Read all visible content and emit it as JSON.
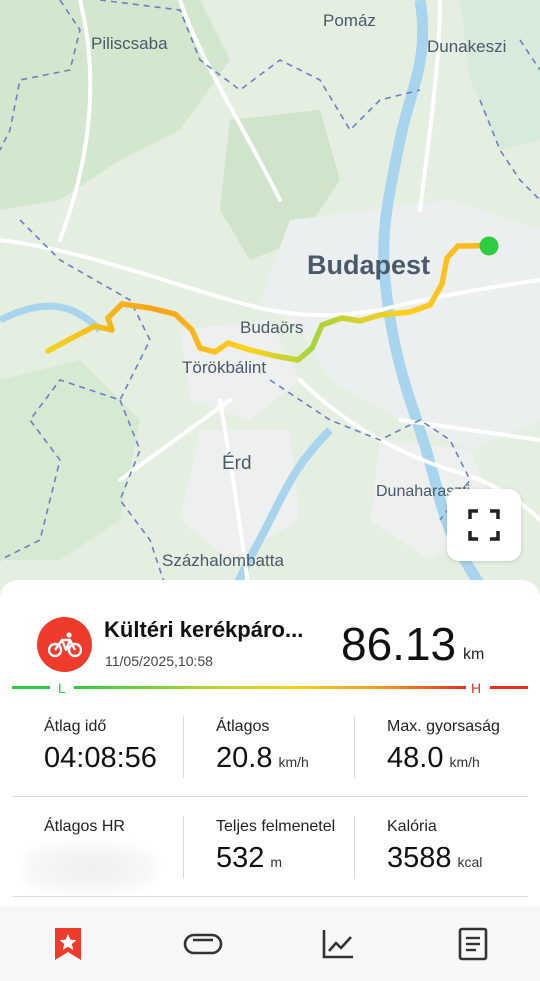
{
  "map": {
    "place_labels": [
      "Pomáz",
      "Piliscsaba",
      "Dunakeszi",
      "Budapest",
      "Budaörs",
      "Törökbálint",
      "Érd",
      "Dunaharaszti",
      "Százhalombatta"
    ]
  },
  "colors": {
    "accent": "#ef3b2c",
    "low": "#2ecc40",
    "high": "#e8321e",
    "route_start": "#2ecc40"
  },
  "activity": {
    "icon": "cycling-icon",
    "title": "Kültéri kerékpáro...",
    "datetime": "11/05/2025,10:58",
    "distance": "86.13",
    "distance_unit": "km"
  },
  "scale": {
    "low_label": "L",
    "high_label": "H"
  },
  "stats": {
    "avg_time": {
      "label": "Átlag idő",
      "value": "04:08:56",
      "unit": ""
    },
    "avg_speed": {
      "label": "Átlagos",
      "value": "20.8",
      "unit": "km/h"
    },
    "max_speed": {
      "label": "Max. gyorsaság",
      "value": "48.0",
      "unit": "km/h"
    },
    "avg_hr": {
      "label": "Átlagos HR",
      "value": "",
      "unit": ""
    },
    "total_ascent": {
      "label": "Teljes felmenetel",
      "value": "532",
      "unit": "m"
    },
    "calories": {
      "label": "Kalória",
      "value": "3588",
      "unit": "kcal"
    }
  },
  "nav": [
    {
      "name": "nav-bookmark",
      "icon": "bookmark-star-icon",
      "active": true
    },
    {
      "name": "nav-band",
      "icon": "band-icon",
      "active": false
    },
    {
      "name": "nav-chart",
      "icon": "line-chart-icon",
      "active": false
    },
    {
      "name": "nav-details",
      "icon": "document-icon",
      "active": false
    }
  ]
}
